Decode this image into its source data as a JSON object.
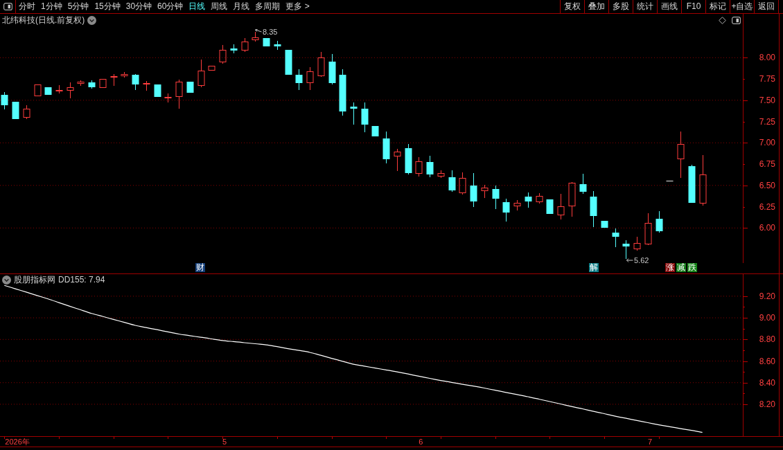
{
  "toolbar": {
    "periods": [
      {
        "label": "分时",
        "selected": false
      },
      {
        "label": "1分钟",
        "selected": false
      },
      {
        "label": "5分钟",
        "selected": false
      },
      {
        "label": "15分钟",
        "selected": false
      },
      {
        "label": "30分钟",
        "selected": false
      },
      {
        "label": "60分钟",
        "selected": false
      },
      {
        "label": "日线",
        "selected": true
      },
      {
        "label": "周线",
        "selected": false
      },
      {
        "label": "月线",
        "selected": false
      },
      {
        "label": "多周期",
        "selected": false
      },
      {
        "label": "更多 >",
        "selected": false
      }
    ],
    "actions": [
      "复权",
      "叠加",
      "多股",
      "统计",
      "画线",
      "F10",
      "标记",
      "+自选",
      "返回"
    ]
  },
  "price_chart": {
    "title": "北纬科技(日线.前复权)",
    "high_label": "8.35",
    "low_label": "5.62",
    "axis_labels": [
      "8.00",
      "7.75",
      "7.50",
      "7.25",
      "7.00",
      "6.75",
      "6.50",
      "6.25",
      "6.00"
    ],
    "events": [
      {
        "text": "财",
        "color": "#123d78"
      },
      {
        "text": "解",
        "color": "#0d7d86"
      },
      {
        "text": "涨",
        "color": "#8a0c0c"
      },
      {
        "text": "减",
        "color": "#137a18"
      },
      {
        "text": "跌",
        "color": "#17851a"
      }
    ]
  },
  "indicator": {
    "name": "股朋指标网",
    "reading": "DD155: 7.94",
    "chart_data": {
      "type": "line",
      "categories": [
        null,
        "2026年",
        null,
        null,
        null,
        null,
        null,
        null,
        null,
        null,
        null,
        null,
        null,
        null,
        null,
        null,
        null,
        null,
        null,
        null,
        "5",
        null,
        null,
        null,
        null,
        null,
        null,
        null,
        null,
        null,
        null,
        null,
        null,
        null,
        null,
        null,
        null,
        null,
        "6",
        null,
        null,
        null,
        null,
        null,
        null,
        null,
        null,
        null,
        null,
        null,
        null,
        null,
        null,
        null,
        null,
        null,
        null,
        null,
        null,
        "7",
        null,
        null,
        null,
        null,
        null
      ],
      "series": [
        {
          "color": "#ffffff",
          "values": [
            9.3,
            9.269,
            9.238,
            9.206,
            9.175,
            9.141,
            9.107,
            9.074,
            9.04,
            9.013,
            8.985,
            8.958,
            8.93,
            8.91,
            8.89,
            8.87,
            8.85,
            8.835,
            8.82,
            8.805,
            8.79,
            8.78,
            8.77,
            8.76,
            8.75,
            8.733,
            8.715,
            8.698,
            8.68,
            8.653,
            8.625,
            8.598,
            8.57,
            8.553,
            8.535,
            8.518,
            8.5,
            8.48,
            8.46,
            8.44,
            8.42,
            8.403,
            8.385,
            8.368,
            8.35,
            8.33,
            8.31,
            8.29,
            8.27,
            8.248,
            8.225,
            8.203,
            8.18,
            8.158,
            8.135,
            8.113,
            8.09,
            8.07,
            8.05,
            8.03,
            8.01,
            7.993,
            7.975,
            7.958,
            7.94
          ]
        }
      ],
      "ylim": [
        7.905,
        9.404
      ],
      "yticks": [
        {
          "value": 9.2,
          "label": "9.20"
        },
        {
          "value": 9.0,
          "label": "9.00"
        },
        {
          "value": 8.8,
          "label": "8.80"
        },
        {
          "value": 8.6,
          "label": "8.60"
        },
        {
          "value": 8.4,
          "label": "8.40"
        },
        {
          "value": 8.2,
          "label": "8.20"
        }
      ],
      "grid": true
    }
  }
}
